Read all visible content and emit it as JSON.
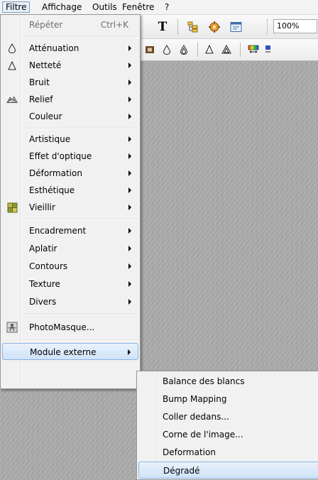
{
  "menubar": {
    "items": [
      "Filtre",
      "Affichage",
      "Outils",
      "Fenêtre",
      "?"
    ]
  },
  "toolbar": {
    "zoom_value": "100%"
  },
  "filter_menu": {
    "repeat_label": "Répéter",
    "repeat_shortcut": "Ctrl+K",
    "items": [
      "Atténuation",
      "Netteté",
      "Bruit",
      "Relief",
      "Couleur",
      "Artistique",
      "Effet d'optique",
      "Déformation",
      "Esthétique",
      "Vieillir",
      "Encadrement",
      "Aplatir",
      "Contours",
      "Texture",
      "Divers",
      "PhotoMasque...",
      "Module externe"
    ]
  },
  "plugin_submenu": {
    "items": [
      "Balance des blancs",
      "Bump Mapping",
      "Coller dedans...",
      "Corne de l'image...",
      "Deformation",
      "Dégradé"
    ]
  },
  "colors": {
    "highlight_border": "#88b3e5",
    "highlight_fill": "#cfe3f8",
    "menu_bg": "#f1f1f1"
  }
}
